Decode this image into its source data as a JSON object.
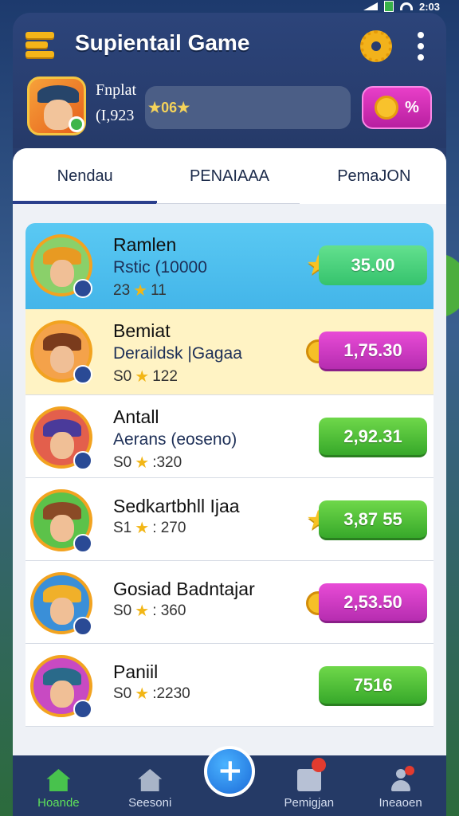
{
  "status": {
    "time": "2:03"
  },
  "header": {
    "title": "Supientail Game",
    "profile_name": "Fnplat",
    "profile_sub": "(I,923",
    "rating_text": "★06★",
    "coins_label": "%"
  },
  "tabs": [
    {
      "label": "Nendau",
      "active": true
    },
    {
      "label": "PENAIAAA",
      "active": false
    },
    {
      "label": "PemaJON",
      "active": false
    }
  ],
  "players": [
    {
      "name": "Ramlen",
      "sub": "Rstic (10000",
      "stats_a": "23",
      "stats_b": "11",
      "score": "35.00",
      "lead": "star",
      "style": "teal",
      "hat": "#e89a22",
      "bg": "#8ad06a",
      "highlight": "blue"
    },
    {
      "name": "Bemiat",
      "sub": "Deraildsk |Gagaa",
      "stats_a": "S0",
      "stats_b": "122",
      "score": "1,75.30",
      "lead": "coin",
      "style": "magenta",
      "hat": "#7a3b1c",
      "bg": "#f4a24a",
      "highlight": "yellow"
    },
    {
      "name": "Antall",
      "sub": "Aerans (eoseno)",
      "stats_a": "S0",
      "stats_b": ":320",
      "score": "2,92.31",
      "lead": "",
      "style": "green",
      "hat": "#4a3a9a",
      "bg": "#e35f4c",
      "highlight": ""
    },
    {
      "name": "Sedkartbhll Ijaa",
      "sub": "",
      "stats_a": "S1",
      "stats_b": ": 270",
      "score": "3,87 55",
      "lead": "star",
      "style": "green",
      "hat": "#8a4a26",
      "bg": "#5cc24a",
      "highlight": ""
    },
    {
      "name": "Gosiad Badntajar",
      "sub": "",
      "stats_a": "S0",
      "stats_b": ": 360",
      "score": "2,53.50",
      "lead": "coin",
      "style": "magenta",
      "hat": "#f0b02a",
      "bg": "#3a8fd8",
      "highlight": ""
    },
    {
      "name": "Paniil",
      "sub": "",
      "stats_a": "S0",
      "stats_b": ":2230",
      "score": "7516",
      "lead": "",
      "style": "green",
      "hat": "#2a6a8a",
      "bg": "#c84ac2",
      "highlight": ""
    }
  ],
  "nav": [
    {
      "label": "Hoande",
      "icon": "home-icon",
      "active": true
    },
    {
      "label": "Seesoni",
      "icon": "house-icon",
      "active": false
    },
    {
      "label": "Pemigjan",
      "icon": "mail-icon",
      "active": false
    },
    {
      "label": "Ineaoen",
      "icon": "user-icon",
      "active": false
    }
  ],
  "colors": {
    "accent": "#2a3f8c",
    "green": "#37a82a",
    "magenta": "#b62db0",
    "highlight_blue": "#43b5e9",
    "highlight_yellow": "#fff3c4"
  }
}
